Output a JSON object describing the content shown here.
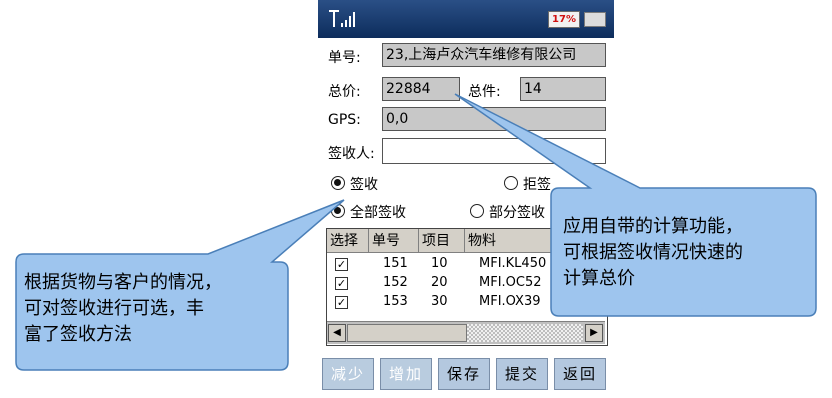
{
  "status_bar": {
    "battery": "17%",
    "signal_icon": "signal-icon",
    "keyboard_icon": "keyboard-icon"
  },
  "form": {
    "order_label": "单号:",
    "order_value": "23,上海卢众汽车维修有限公司",
    "total_price_label": "总价:",
    "total_price_value": "22884",
    "total_items_label": "总件:",
    "total_items_value": "14",
    "gps_label": "GPS:",
    "gps_value": "0,0",
    "signer_label": "签收人:",
    "signer_value": ""
  },
  "options": {
    "sign": "签收",
    "reject": "拒签",
    "full": "全部签收",
    "partial": "部分签收",
    "selected_primary": "签收",
    "selected_secondary": "全部签收"
  },
  "table": {
    "columns": [
      "选择",
      "单号",
      "项目",
      "物料"
    ],
    "rows": [
      {
        "checked": true,
        "order": "151",
        "item": "10",
        "material": "MFI.KL450"
      },
      {
        "checked": true,
        "order": "152",
        "item": "20",
        "material": "MFI.OC52"
      },
      {
        "checked": true,
        "order": "153",
        "item": "30",
        "material": "MFI.OX39"
      }
    ]
  },
  "buttons": {
    "reduce": "减少",
    "add": "增加",
    "save": "保存",
    "submit": "提交",
    "back": "返回"
  },
  "callouts": {
    "left": [
      "根据货物与客户的情况，",
      "可对签收进行可选，丰",
      "富了签收方法"
    ],
    "right": [
      "应用自带的计算功能，",
      "可根据签收情况快速的",
      "计算总价"
    ]
  },
  "colors": {
    "title_bar": "#1a3b6e",
    "callout_fill": "#9ec5ee",
    "button_fill": "#b4c8df",
    "field_fill": "#c8c8c8"
  }
}
